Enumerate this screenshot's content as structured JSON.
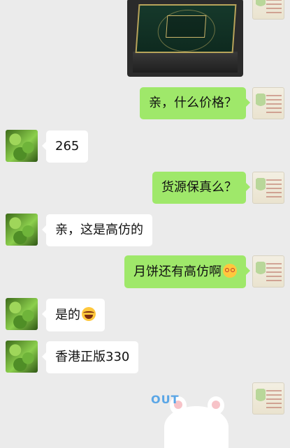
{
  "chat": {
    "messages": [
      {
        "side": "right",
        "text": "亲，什么价格？"
      },
      {
        "side": "left",
        "text": "265"
      },
      {
        "side": "right",
        "text": "货源保真么？"
      },
      {
        "side": "left",
        "text": "亲，这是高仿的"
      },
      {
        "side": "right",
        "text": "月饼还有高仿啊",
        "emoji": "dizzy-face-emoji"
      },
      {
        "side": "left",
        "text": "是的",
        "emoji": "laughing-tears-emoji"
      },
      {
        "side": "left",
        "text": "香港正版330"
      }
    ]
  },
  "sticker": {
    "text": "OUT"
  },
  "colors": {
    "background": "#ebebeb",
    "sent_bubble": "#9fe86a",
    "received_bubble": "#ffffff"
  }
}
